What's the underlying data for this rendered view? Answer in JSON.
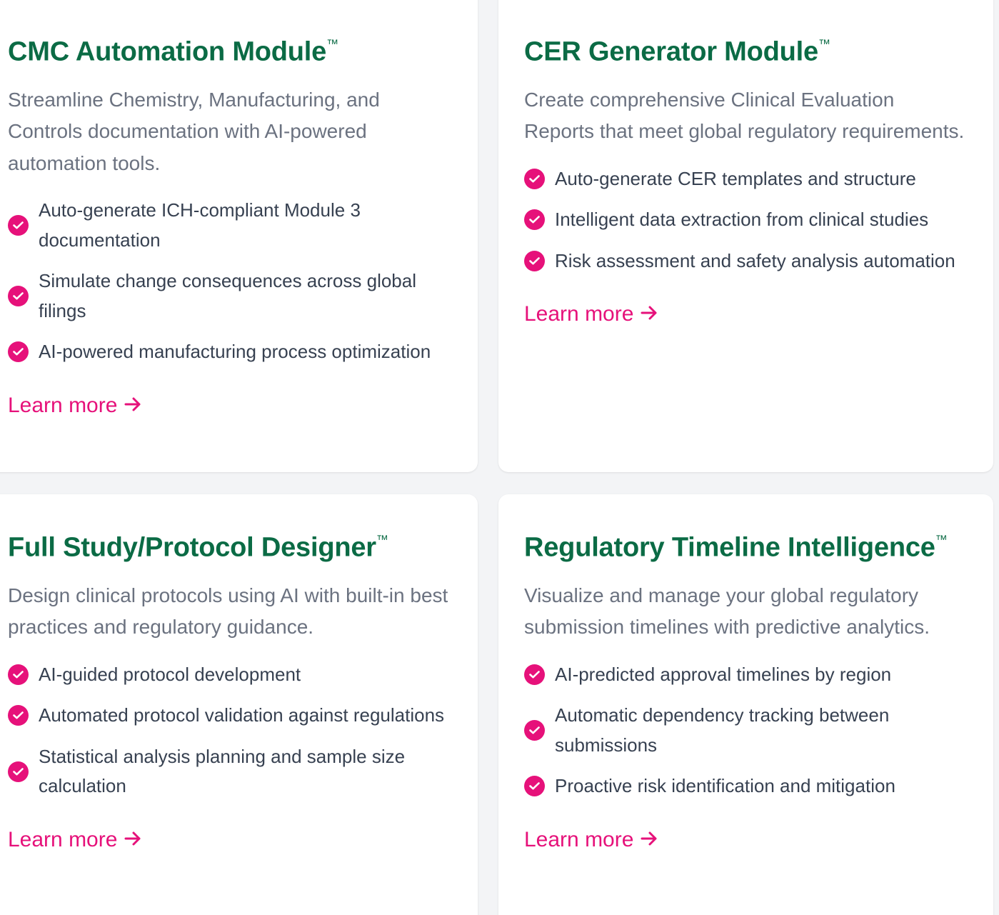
{
  "cards": [
    {
      "title": "CMC Automation Module",
      "tm": "™",
      "description": "Streamline Chemistry, Manufacturing, and Controls documentation with AI-powered automation tools.",
      "features": [
        "Auto-generate ICH-compliant Module 3 documentation",
        "Simulate change consequences across global filings",
        "AI-powered manufacturing process optimization"
      ],
      "link": "Learn more"
    },
    {
      "title": "CER Generator Module",
      "tm": "™",
      "description": "Create comprehensive Clinical Evaluation Reports that meet global regulatory requirements.",
      "features": [
        "Auto-generate CER templates and structure",
        "Intelligent data extraction from clinical studies",
        "Risk assessment and safety analysis automation"
      ],
      "link": "Learn more"
    },
    {
      "title": "Full Study/Protocol Designer",
      "tm": "™",
      "description": "Design clinical protocols using AI with built-in best practices and regulatory guidance.",
      "features": [
        "AI-guided protocol development",
        "Automated protocol validation against regulations",
        "Statistical analysis planning and sample size calculation"
      ],
      "link": "Learn more"
    },
    {
      "title": "Regulatory Timeline Intelligence",
      "tm": "™",
      "description": "Visualize and manage your global regulatory submission timelines with predictive analytics.",
      "features": [
        "AI-predicted approval timelines by region",
        "Automatic dependency tracking between submissions",
        "Proactive risk identification and mitigation"
      ],
      "link": "Learn more"
    }
  ],
  "icons": {
    "feature_check": "check-circle-icon",
    "link_arrow": "arrow-right-icon"
  },
  "colors": {
    "title": "#0b6b45",
    "accent": "#e6117a",
    "description": "#6b7280",
    "feature_text": "#374151",
    "card_bg": "#ffffff",
    "page_bg": "#f3f4f6"
  }
}
